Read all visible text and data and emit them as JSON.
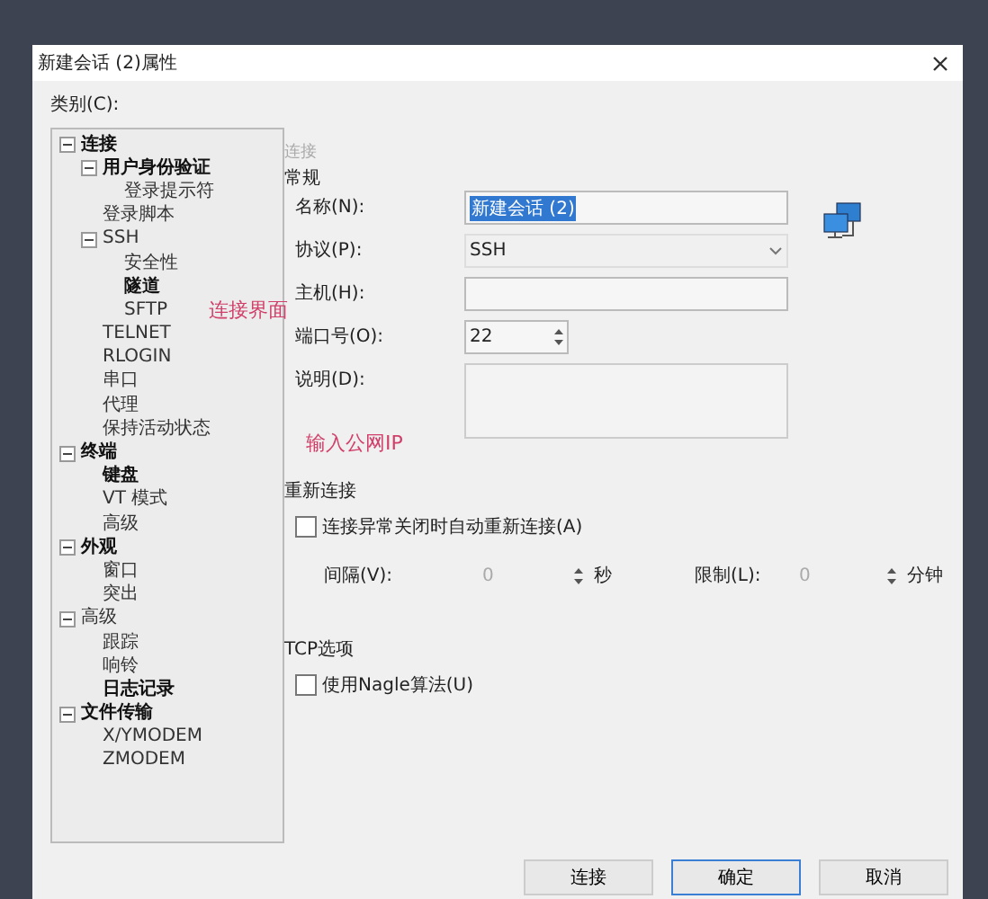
{
  "window": {
    "title": "新建会话 (2)属性"
  },
  "category_label": "类别(C):",
  "tree": [
    {
      "label": "连接",
      "emphasized": true,
      "expanded": true,
      "selected": false,
      "children": [
        {
          "label": "用户身份验证",
          "emphasized": true,
          "expanded": true,
          "selected": false,
          "children": [
            {
              "label": "登录提示符",
              "emphasized": false,
              "selected": false
            }
          ]
        },
        {
          "label": "登录脚本",
          "emphasized": false,
          "selected": false
        },
        {
          "label": "SSH",
          "emphasized": false,
          "expanded": true,
          "selected": false,
          "children": [
            {
              "label": "安全性",
              "emphasized": false,
              "selected": false
            },
            {
              "label": "隧道",
              "emphasized": true,
              "selected": false
            },
            {
              "label": "SFTP",
              "emphasized": false,
              "selected": false
            }
          ]
        },
        {
          "label": "TELNET",
          "emphasized": false,
          "selected": false
        },
        {
          "label": "RLOGIN",
          "emphasized": false,
          "selected": false
        },
        {
          "label": "串口",
          "emphasized": false,
          "selected": false
        },
        {
          "label": "代理",
          "emphasized": false,
          "selected": false
        },
        {
          "label": "保持活动状态",
          "emphasized": false,
          "selected": false
        }
      ]
    },
    {
      "label": "终端",
      "emphasized": true,
      "expanded": true,
      "selected": false,
      "children": [
        {
          "label": "键盘",
          "emphasized": true,
          "selected": false
        },
        {
          "label": "VT 模式",
          "emphasized": false,
          "selected": false
        },
        {
          "label": "高级",
          "emphasized": false,
          "selected": false
        }
      ]
    },
    {
      "label": "外观",
      "emphasized": true,
      "expanded": true,
      "selected": false,
      "children": [
        {
          "label": "窗口",
          "emphasized": false,
          "selected": false
        },
        {
          "label": "突出",
          "emphasized": false,
          "selected": false
        }
      ]
    },
    {
      "label": "高级",
      "emphasized": false,
      "expanded": true,
      "selected": false,
      "children": [
        {
          "label": "跟踪",
          "emphasized": false,
          "selected": false
        },
        {
          "label": "响铃",
          "emphasized": false,
          "selected": false
        },
        {
          "label": "日志记录",
          "emphasized": true,
          "selected": false
        }
      ]
    },
    {
      "label": "文件传输",
      "emphasized": true,
      "expanded": true,
      "selected": false,
      "children": [
        {
          "label": "X/YMODEM",
          "emphasized": false,
          "selected": false
        },
        {
          "label": "ZMODEM",
          "emphasized": false,
          "selected": false
        }
      ]
    }
  ],
  "panel": {
    "title": "连接",
    "general": {
      "heading": "常规",
      "fields": [
        {
          "kind": "text",
          "label": "名称(N):",
          "value": "新建会话 (2)",
          "highlighted": true
        },
        {
          "kind": "select",
          "label": "协议(P):",
          "value": "SSH"
        },
        {
          "kind": "text",
          "label": "主机(H):"
        },
        {
          "kind": "spinner",
          "label": "端口号(O):",
          "value": "22"
        },
        {
          "kind": "textarea",
          "label": "说明(D):"
        }
      ]
    },
    "reconnect": {
      "heading": "重新连接",
      "checkbox": {
        "label": "连接异常关闭时自动重新连接(A)",
        "checked": false
      },
      "interval": {
        "label": "间隔(V):",
        "value": "0",
        "unit": "秒",
        "disabled": true
      },
      "limit": {
        "label": "限制(L):",
        "value": "0",
        "unit": "分钟",
        "disabled": true
      }
    },
    "tcp": {
      "heading": "TCP选项",
      "checkbox": {
        "label": "使用Nagle算法(U)",
        "checked": false
      }
    }
  },
  "annotations": [
    {
      "text": "连接界面"
    },
    {
      "text": "输入公网IP"
    }
  ],
  "buttons": [
    {
      "label": "连接",
      "default": false
    },
    {
      "label": "确定",
      "default": true
    },
    {
      "label": "取消",
      "default": false
    }
  ]
}
